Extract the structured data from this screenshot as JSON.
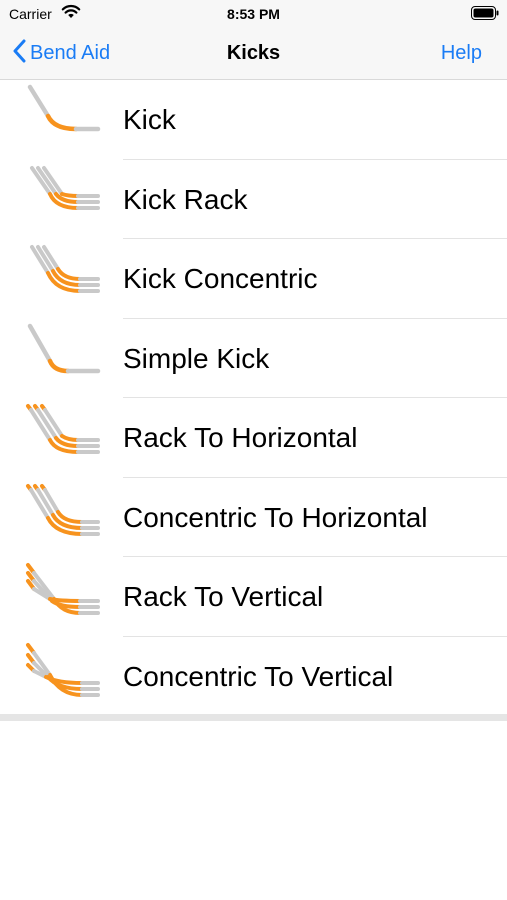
{
  "status": {
    "carrier": "Carrier",
    "time": "8:53 PM"
  },
  "nav": {
    "back_label": "Bend Aid",
    "title": "Kicks",
    "help_label": "Help"
  },
  "colors": {
    "accent": "#1a7cf5",
    "conduit": "#c9c9c9",
    "bend": "#f7931e"
  },
  "items": [
    {
      "label": "Kick",
      "icon": "kick-icon"
    },
    {
      "label": "Kick Rack",
      "icon": "kick-rack-icon"
    },
    {
      "label": "Kick Concentric",
      "icon": "kick-concentric-icon"
    },
    {
      "label": "Simple Kick",
      "icon": "simple-kick-icon"
    },
    {
      "label": "Rack To Horizontal",
      "icon": "rack-to-horizontal-icon"
    },
    {
      "label": "Concentric To Horizontal",
      "icon": "concentric-to-horizontal-icon"
    },
    {
      "label": "Rack To Vertical",
      "icon": "rack-to-vertical-icon"
    },
    {
      "label": "Concentric To Vertical",
      "icon": "concentric-to-vertical-icon"
    }
  ]
}
